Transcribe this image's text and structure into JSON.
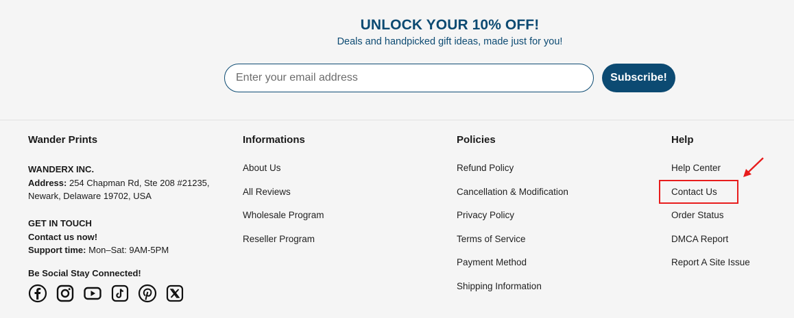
{
  "newsletter": {
    "title": "UNLOCK YOUR 10% OFF!",
    "subtitle": "Deals and handpicked gift ideas, made just for you!",
    "email_placeholder": "Enter your email address",
    "subscribe_label": "Subscribe!"
  },
  "columns": {
    "company": {
      "title": "Wander Prints",
      "name": "WANDERX INC.",
      "address_label": "Address:",
      "address_line1": " 254 Chapman Rd, Ste 208 #21235,",
      "address_line2": "Newark, Delaware 19702, USA",
      "touch_title": "GET IN TOUCH",
      "contact": "Contact us now!",
      "support_label": "Support time:",
      "support_value": " Mon–Sat: 9AM-5PM",
      "social_title": "Be Social Stay Connected!",
      "social_icons": [
        "facebook-icon",
        "instagram-icon",
        "youtube-icon",
        "tiktok-icon",
        "pinterest-icon",
        "x-icon"
      ]
    },
    "informations": {
      "title": "Informations",
      "links": [
        "About Us",
        "All Reviews",
        "Wholesale Program",
        "Reseller Program"
      ]
    },
    "policies": {
      "title": "Policies",
      "links": [
        "Refund Policy",
        "Cancellation & Modification",
        "Privacy Policy",
        "Terms of Service",
        "Payment Method",
        "Shipping Information"
      ]
    },
    "help": {
      "title": "Help",
      "links": [
        "Help Center",
        "Contact Us",
        "Order Status",
        "DMCA Report",
        "Report A Site Issue"
      ]
    }
  },
  "colors": {
    "brand": "#0c4a72",
    "background": "#f5f5f5",
    "annotation": "#e81c1c"
  }
}
